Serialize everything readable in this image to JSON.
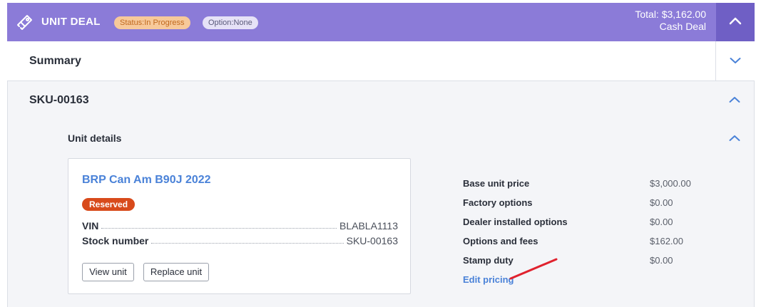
{
  "header": {
    "title": "UNIT DEAL",
    "status_badge": "Status:In Progress",
    "option_badge": "Option:None",
    "total_line": "Total: $3,162.00",
    "deal_type": "Cash Deal",
    "color": "#8b7bd8"
  },
  "summary": {
    "label": "Summary"
  },
  "sku_section": {
    "label": "SKU-00163"
  },
  "unit_details": {
    "label": "Unit details",
    "unit_name": "BRP Can Am B90J 2022",
    "reserved_badge": "Reserved",
    "vin_label": "VIN",
    "vin_value": "BLABLA1113",
    "stock_label": "Stock number",
    "stock_value": "SKU-00163",
    "view_button": "View unit",
    "replace_button": "Replace unit"
  },
  "pricing": {
    "rows": [
      {
        "label": "Base unit price",
        "value": "$3,000.00"
      },
      {
        "label": "Factory options",
        "value": "$0.00"
      },
      {
        "label": "Dealer installed options",
        "value": "$0.00"
      },
      {
        "label": "Options and fees",
        "value": "$162.00"
      },
      {
        "label": "Stamp duty",
        "value": "$0.00"
      }
    ],
    "edit_link": "Edit pricing"
  },
  "icons": {
    "logo": "deal-handshake-icon",
    "collapse": "chevron-up-icon",
    "expand": "chevron-down-icon"
  }
}
